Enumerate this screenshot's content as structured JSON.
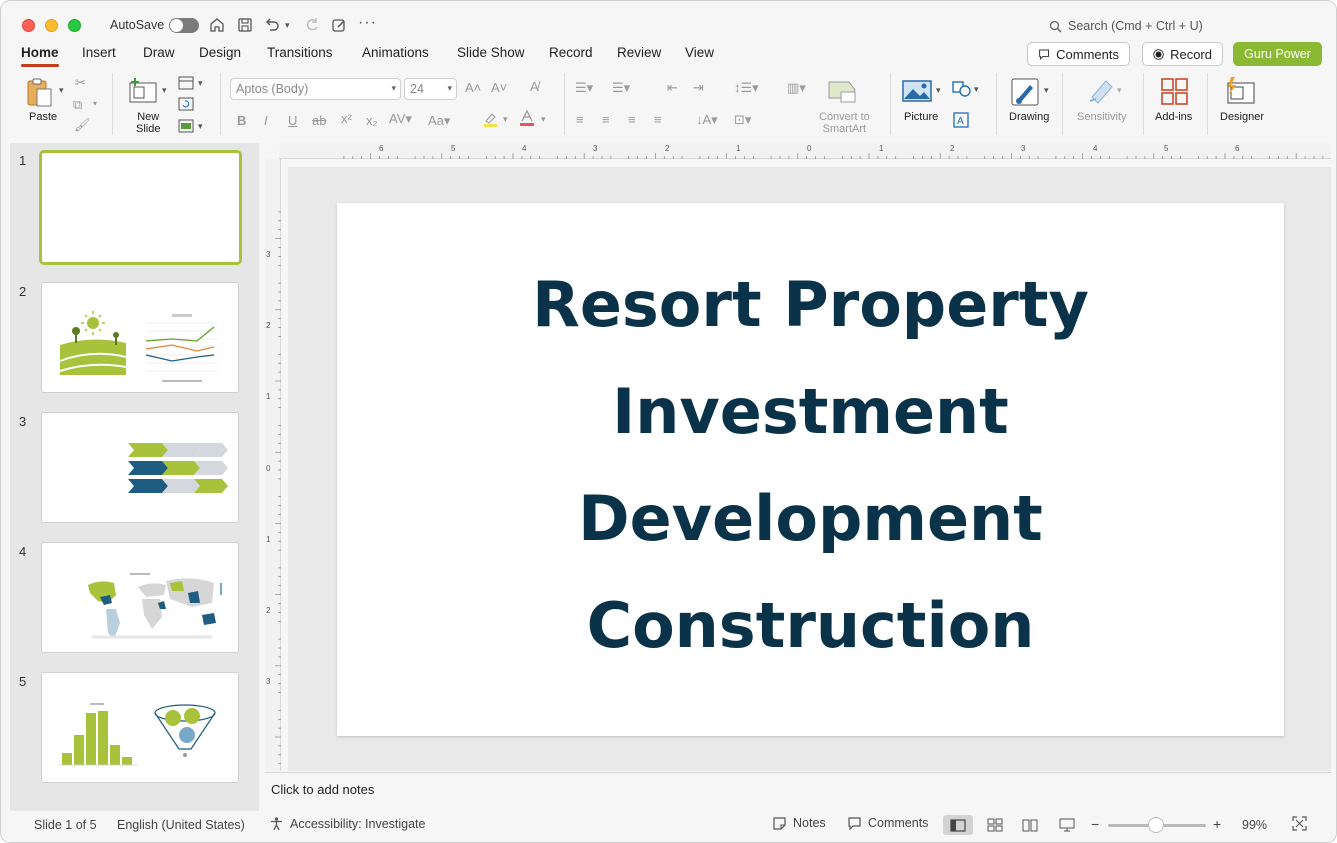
{
  "titlebar": {
    "autosave_label": "AutoSave",
    "search_placeholder": "Search (Cmd + Ctrl + U)"
  },
  "tabs": [
    {
      "label": "Home",
      "active": true
    },
    {
      "label": "Insert"
    },
    {
      "label": "Draw"
    },
    {
      "label": "Design"
    },
    {
      "label": "Transitions"
    },
    {
      "label": "Animations"
    },
    {
      "label": "Slide Show"
    },
    {
      "label": "Record"
    },
    {
      "label": "Review"
    },
    {
      "label": "View"
    }
  ],
  "header_buttons": {
    "comments": "Comments",
    "record": "Record",
    "guru": "Guru Power"
  },
  "ribbon": {
    "paste": "Paste",
    "new_slide_line1": "New",
    "new_slide_line2": "Slide",
    "font_name": "Aptos (Body)",
    "font_size": "24",
    "convert_line1": "Convert to",
    "convert_line2": "SmartArt",
    "picture": "Picture",
    "drawing": "Drawing",
    "sensitivity": "Sensitivity",
    "addins": "Add-ins",
    "designer": "Designer"
  },
  "thumbnails": [
    {
      "number": "1"
    },
    {
      "number": "2"
    },
    {
      "number": "3"
    },
    {
      "number": "4"
    },
    {
      "number": "5"
    }
  ],
  "ruler": {
    "top": [
      "6",
      "5",
      "4",
      "3",
      "2",
      "1",
      "0",
      "1",
      "2",
      "3",
      "4",
      "5",
      "6"
    ],
    "left": [
      "3",
      "2",
      "1",
      "0",
      "1",
      "2",
      "3"
    ]
  },
  "slide": {
    "title_lines": [
      "Resort Property",
      "Investment",
      "Development",
      "Construction"
    ]
  },
  "notes_placeholder": "Click to add notes",
  "status": {
    "slide_counter": "Slide 1 of 5",
    "language": "English (United States)",
    "accessibility": "Accessibility: Investigate",
    "notes": "Notes",
    "comments": "Comments",
    "zoom": "99%",
    "zoom_fraction": 0.5
  },
  "colors": {
    "accent_tab": "#c43e1c",
    "guru_green": "#8cb933",
    "title_navy": "#0a3349",
    "thumb_green": "#a8c23c",
    "thumb_blue": "#1f5c82"
  }
}
